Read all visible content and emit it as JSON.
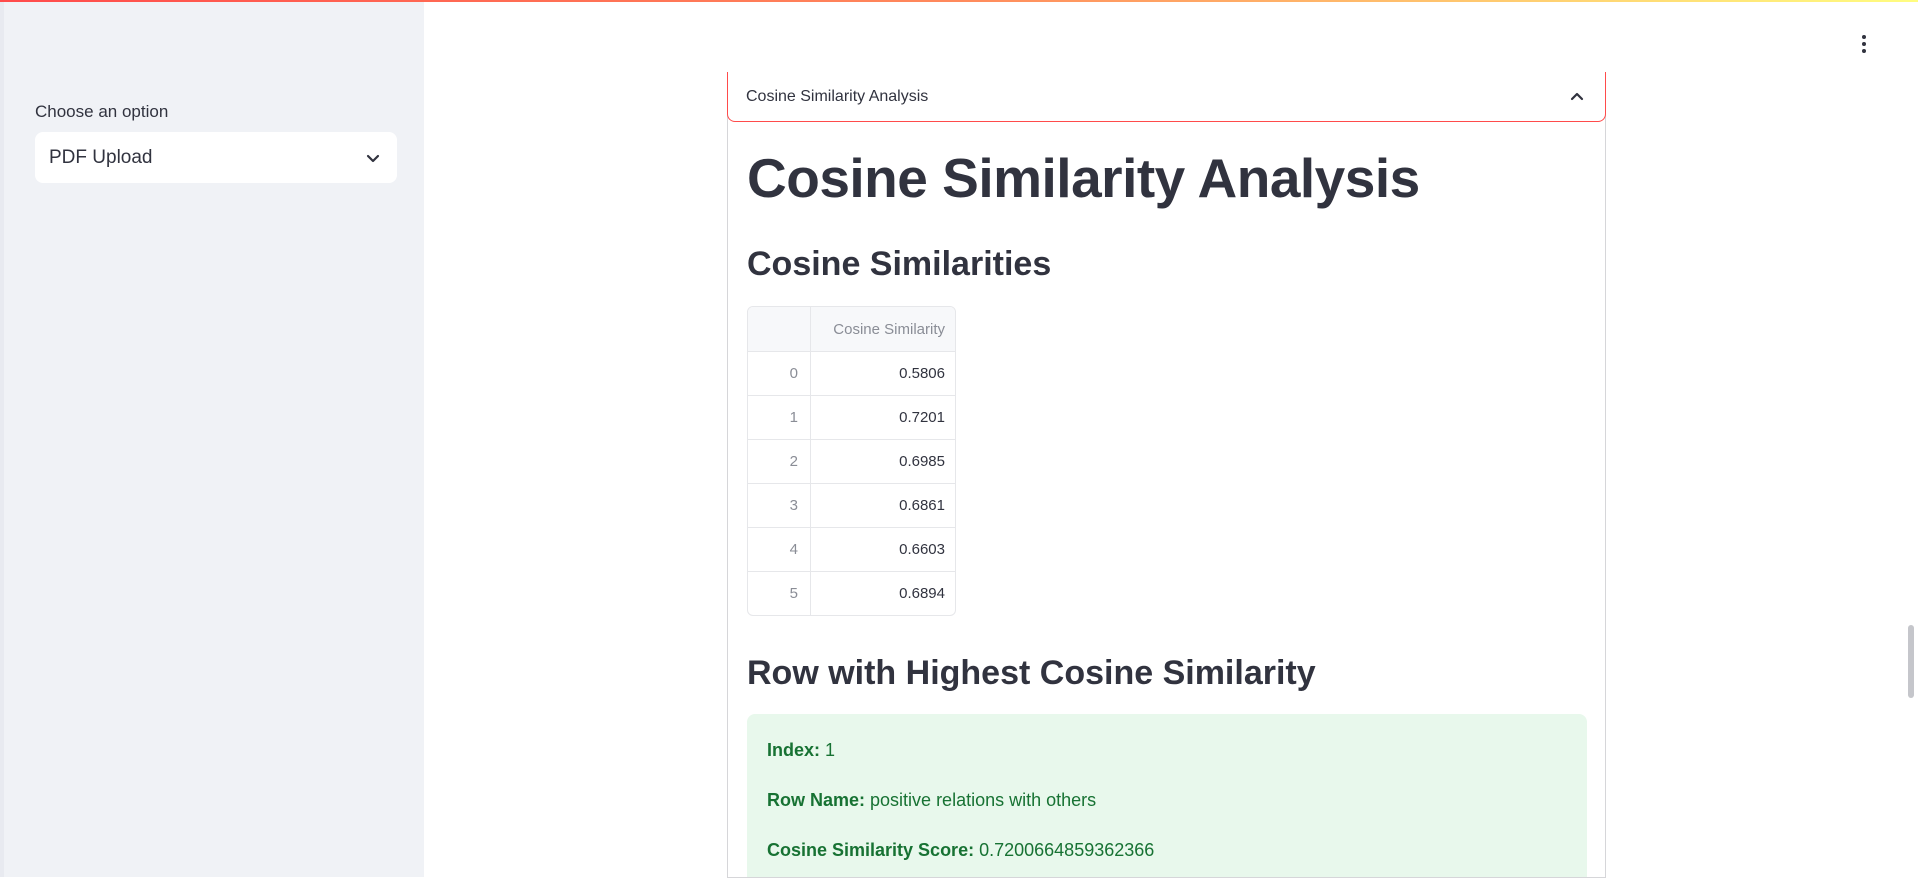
{
  "sidebar": {
    "label": "Choose an option",
    "select_value": "PDF Upload",
    "select_icon": "chevron-down-icon"
  },
  "main_menu_icon": "vertical-ellipsis-icon",
  "expander": {
    "title": "Cosine Similarity Analysis",
    "icon": "chevron-up-icon"
  },
  "content": {
    "heading": "Cosine Similarity Analysis",
    "table_heading": "Cosine Similarities",
    "table": {
      "columns": [
        "",
        "Cosine Similarity"
      ],
      "rows": [
        {
          "index": "0",
          "value": "0.5806"
        },
        {
          "index": "1",
          "value": "0.7201"
        },
        {
          "index": "2",
          "value": "0.6985"
        },
        {
          "index": "3",
          "value": "0.6861"
        },
        {
          "index": "4",
          "value": "0.6603"
        },
        {
          "index": "5",
          "value": "0.6894"
        }
      ]
    },
    "best_heading": "Row with Highest Cosine Similarity",
    "best": {
      "index_label": "Index:",
      "index_value": "1",
      "row_name_label": "Row Name:",
      "row_name_value": "positive relations with others",
      "score_label": "Cosine Similarity Score:",
      "score_value": "0.7200664859362366"
    }
  },
  "colors": {
    "accent": "#ff4b4b",
    "success_bg": "#e8f8ec",
    "success_text": "#177233",
    "sidebar_bg": "#f0f2f6"
  }
}
